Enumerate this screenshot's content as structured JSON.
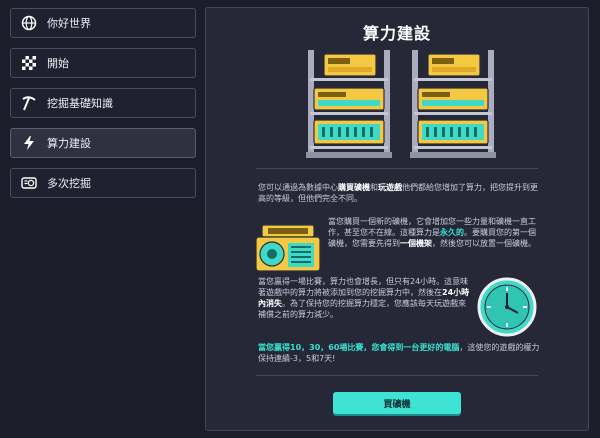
{
  "sidebar": {
    "items": [
      {
        "label": "你好世界",
        "icon": "globe-icon"
      },
      {
        "label": "開始",
        "icon": "checkered-flag-icon"
      },
      {
        "label": "挖掘基礎知識",
        "icon": "pickaxe-icon"
      },
      {
        "label": "算力建設",
        "icon": "lightning-icon",
        "active": true
      },
      {
        "label": "多次挖掘",
        "icon": "mining-rig-icon"
      }
    ]
  },
  "main": {
    "title": "算力建設",
    "intro": {
      "p1": "您可以通過為數據中心",
      "b1": "購買礦機",
      "p2": "和",
      "b2": "玩遊戲",
      "p3": "他們都給您增加了算力，把您提升到更高的等級，但他們完全不同。"
    },
    "buy_info": {
      "p1": "當您購買一個新的礦機，它會增加您一些力量和礦機一直工作，甚至您不在線。這種算力是",
      "t1": "永久的",
      "p2": "。要購買您的第一個礦機，您需要先得到",
      "b1": "一個機架",
      "p3": "，然後您可以放置一個礦機。"
    },
    "game_info": {
      "p1": "當您贏得一場比賽，算力也會增長，但只有24小時。這意味著遊戲中的算力將被添加到您的挖掘算力中，然後在",
      "b1": "24小時內消失",
      "p2": "。為了保持您的挖掘算力穩定，您應該每天玩遊戲來補償之前的算力減少。"
    },
    "streak_info": {
      "t1": "當您贏得10，30，60場比賽，您會得到一台更好的電腦",
      "p1": "，這使您的遊戲的權力保持連續-3，5和7天!"
    },
    "buy_button": "買礦機"
  },
  "colors": {
    "accent": "#3fe3d3",
    "background": "#1b1d2a",
    "panel": "#262838",
    "miner_yellow": "#f5c842"
  }
}
